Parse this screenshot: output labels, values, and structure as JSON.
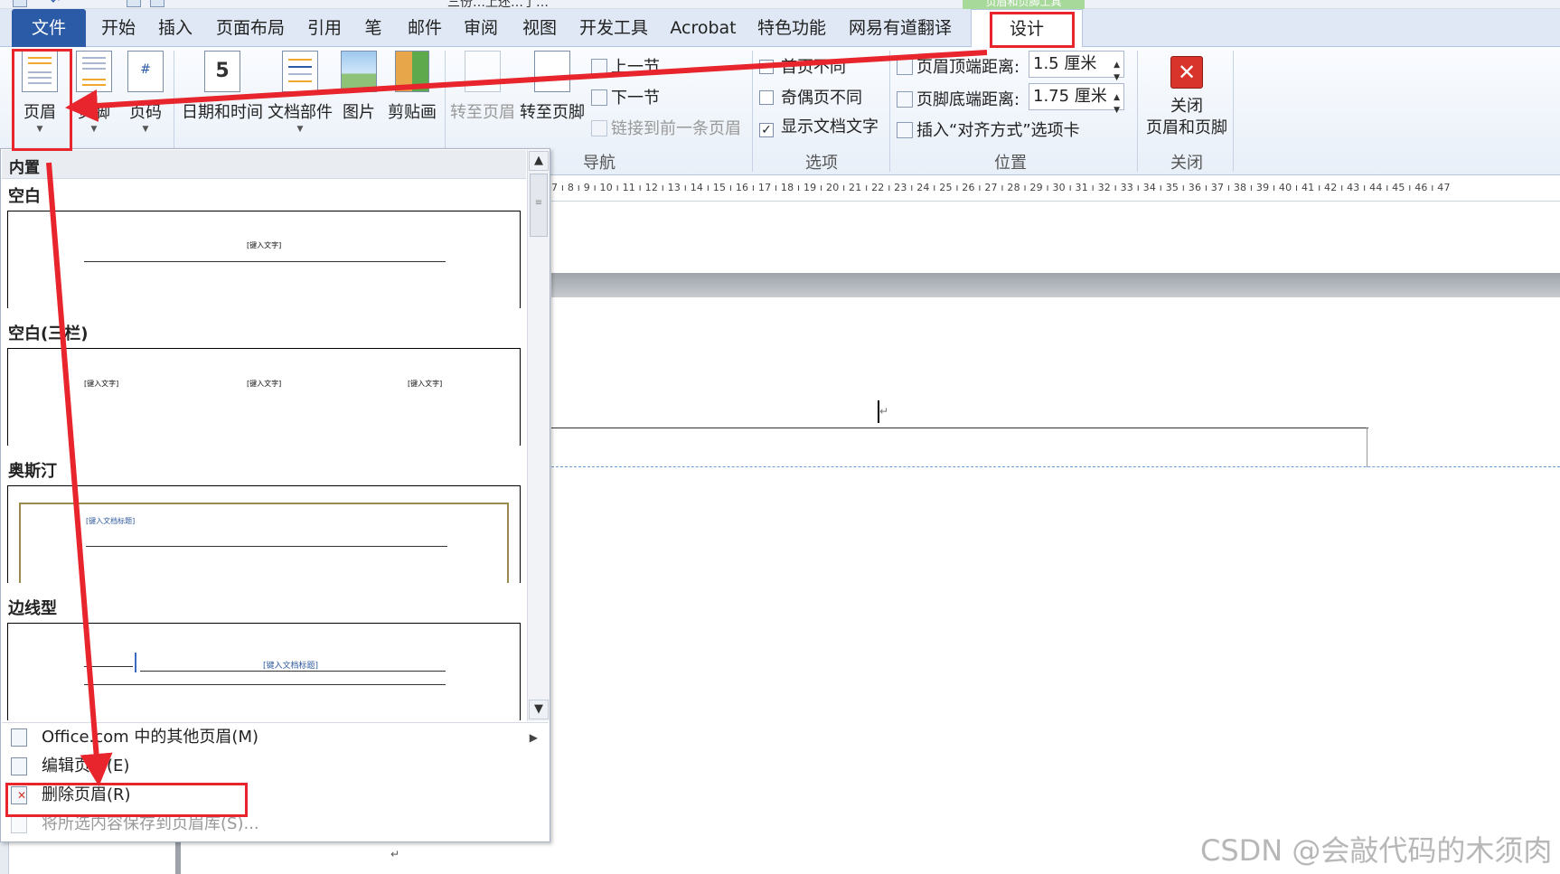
{
  "window": {
    "doc_title": "三份…上还…了…"
  },
  "contextual_tab": "页眉和页脚工具",
  "tabs": [
    "文件",
    "开始",
    "插入",
    "页面布局",
    "引用",
    "笔",
    "邮件",
    "审阅",
    "视图",
    "开发工具",
    "Acrobat",
    "特色功能",
    "网易有道翻译",
    "设计"
  ],
  "ribbon": {
    "header_footer": {
      "header": "页眉",
      "footer": "页脚",
      "page_number": "页码"
    },
    "insert": {
      "datetime": "日期和时间",
      "doc_parts": "文档部件",
      "picture": "图片",
      "clipart": "剪贴画"
    },
    "navigation": {
      "goto_header": "转至页眉",
      "goto_footer": "转至页脚",
      "prev_section": "上一节",
      "next_section": "下一节",
      "link_previous": "链接到前一条页眉",
      "label": "导航"
    },
    "options": {
      "first_page": "首页不同",
      "odd_even": "奇偶页不同",
      "show_doc_text": "显示文档文字",
      "label": "选项",
      "show_doc_text_checked": true
    },
    "position": {
      "header_top_label": "页眉顶端距离:",
      "header_top_value": "1.5 厘米",
      "footer_bottom_label": "页脚底端距离:",
      "footer_bottom_value": "1.75 厘米",
      "insert_align_tab": "插入“对齐方式”选项卡",
      "label": "位置"
    },
    "close": {
      "button": "关闭\n页眉和页脚",
      "line1": "关闭",
      "line2": "页眉和页脚",
      "label": "关闭"
    }
  },
  "ruler": {
    "ticks": "7 ı 8 ı 9 ı 10 ı 11 ı 12 ı 13 ı 14 ı 15 ı 16 ı 17 ı 18 ı 19 ı 20 ı 21 ı 22 ı 23 ı 24 ı 25 ı 26 ı 27 ı 28 ı 29 ı 30 ı 31 ı 32 ı 33 ı 34 ı 35 ı 36 ı 37 ı 38 ı 39 ı 40 ı 41 ı 42 ı 43 ı 44 ı 45 ı 46 ı 47"
  },
  "document": {
    "paragraph_mark": "↵"
  },
  "gallery": {
    "section_header": "内置",
    "items": [
      {
        "title": "空白",
        "placeholders": [
          "[键入文字]"
        ]
      },
      {
        "title": "空白(三栏)",
        "placeholders": [
          "[键入文字]",
          "[键入文字]",
          "[键入文字]"
        ]
      },
      {
        "title": "奥斯汀",
        "placeholders": [
          "[键入文档标题]"
        ]
      },
      {
        "title": "边线型",
        "placeholders": [
          "[键入文档标题]"
        ]
      }
    ],
    "menu": [
      {
        "label": "Office.com 中的其他页眉(M)",
        "has_submenu": true
      },
      {
        "label": "编辑页眉(E)"
      },
      {
        "label": "删除页眉(R)"
      },
      {
        "label": "将所选内容保存到页眉库(S)...",
        "disabled": true
      }
    ]
  },
  "watermark": "CSDN @会敲代码的木须肉",
  "colors": {
    "file_tab": "#2b5aa6",
    "annotation_red": "#e8242c",
    "contextual_green": "#a7d99a"
  }
}
